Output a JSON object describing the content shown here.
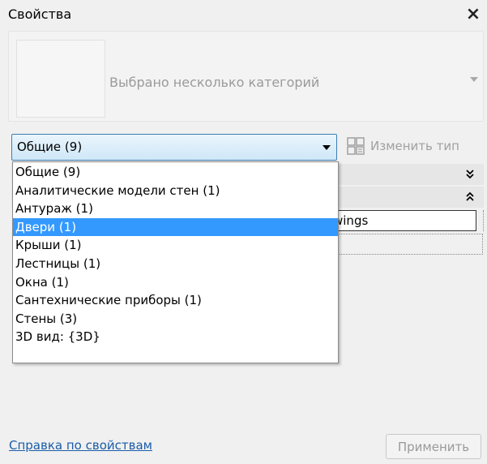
{
  "window": {
    "title": "Свойства",
    "close_icon": "×"
  },
  "type_selector": {
    "label": "Выбрано несколько категорий"
  },
  "filter": {
    "selected": "Общие (9)",
    "options": [
      "Общие (9)",
      "Аналитические модели стен (1)",
      "Антураж (1)",
      "Двери (1)",
      "Крыши (1)",
      "Лестницы (1)",
      "Окна (1)",
      "Сантехнические приборы (1)",
      "Стены (3)",
      "3D вид: {3D}"
    ],
    "highlighted_index": 3
  },
  "edit_type": {
    "label": "Изменить тип"
  },
  "grid": {
    "collapse_all_icon": "»",
    "collapse_group_icon": "«",
    "visible_cell_value": "wings"
  },
  "footer": {
    "help_link": "Справка по свойствам",
    "apply_label": "Применить"
  },
  "colors": {
    "selection": "#3399ff",
    "link": "#1a5da8",
    "combo_border": "#3c7fb1"
  }
}
